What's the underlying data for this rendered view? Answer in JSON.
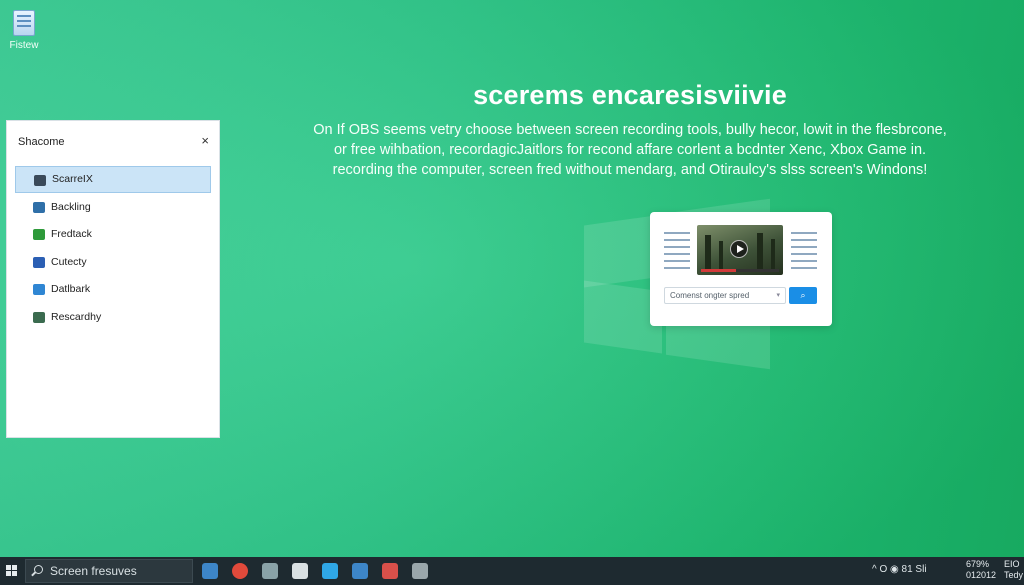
{
  "desktop": {
    "icon_label": "Fistew"
  },
  "hero": {
    "headline": "scerems encaresisviivie",
    "desc_line1": "On If OBS seems vetry choose between screen recording tools, bully hecor, lowit in the flesbrcone,",
    "desc_line2": "or free wihbation, recordagicJaitlors for recond affare corlent a bcdnter Xenc, Xbox Game in.",
    "desc_line3": "recording the computer, screen fred without mendarg, and Otiraulcy's slss screen's Windons!"
  },
  "card": {
    "input_placeholder": "Comenst ongter spred",
    "progress": 0.45
  },
  "panel": {
    "title": "Shacome",
    "close_glyph": "×",
    "items": [
      {
        "label": "ScarreIX",
        "icon": "user-search-icon",
        "active": true,
        "color": "#3a4a5a"
      },
      {
        "label": "Backling",
        "icon": "grid-icon",
        "active": false,
        "color": "#2f6fa8"
      },
      {
        "label": "Fredtack",
        "icon": "feedback-icon",
        "active": false,
        "color": "#2e9a3a"
      },
      {
        "label": "Cutecty",
        "icon": "facebook-icon",
        "active": false,
        "color": "#2b5fb4"
      },
      {
        "label": "Datlbark",
        "icon": "cloud-icon",
        "active": false,
        "color": "#2f86d3"
      },
      {
        "label": "Rescardhy",
        "icon": "document-icon",
        "active": false,
        "color": "#3b6b4f"
      }
    ]
  },
  "taskbar": {
    "search_text": "Screen fresuves",
    "tray_text": "^ O ◉ 81 Sli",
    "clock_line1": "679%",
    "clock_line2": "012012",
    "clock_side1": "EIO",
    "clock_side2": "Tedy",
    "apps": [
      {
        "icon": "folder-icon",
        "color": "#3d86c8"
      },
      {
        "icon": "chrome-icon",
        "color": "#e14a3b"
      },
      {
        "icon": "clock-icon",
        "color": "#8aa3a8"
      },
      {
        "icon": "settings-icon",
        "color": "#d9e1e3"
      },
      {
        "icon": "windows-store-icon",
        "color": "#2fa7e6"
      },
      {
        "icon": "edit-icon",
        "color": "#3d86c8"
      },
      {
        "icon": "media-icon",
        "color": "#d8504a"
      },
      {
        "icon": "gear-icon",
        "color": "#9aa7ab"
      }
    ]
  }
}
